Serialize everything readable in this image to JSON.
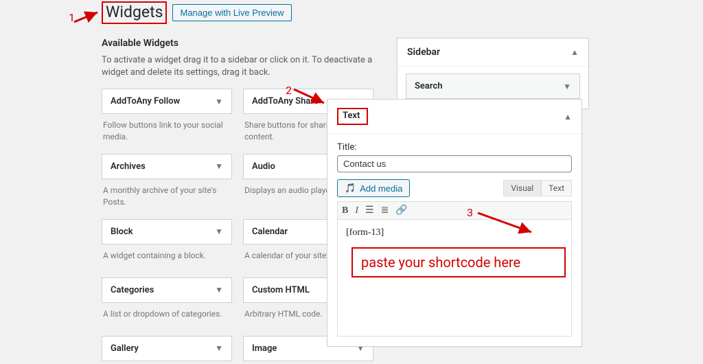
{
  "header": {
    "title": "Widgets",
    "live_preview": "Manage with Live Preview"
  },
  "available": {
    "title": "Available Widgets",
    "desc": "To activate a widget drag it to a sidebar or click on it. To deactivate a widget and delete its settings, drag it back."
  },
  "widgets": [
    {
      "name": "AddToAny Follow",
      "desc": "Follow buttons link to your social media."
    },
    {
      "name": "AddToAny Share",
      "desc": "Share buttons for sharing your content."
    },
    {
      "name": "Archives",
      "desc": "A monthly archive of your site's Posts."
    },
    {
      "name": "Audio",
      "desc": "Displays an audio player."
    },
    {
      "name": "Block",
      "desc": "A widget containing a block."
    },
    {
      "name": "Calendar",
      "desc": "A calendar of your site's posts."
    },
    {
      "name": "Categories",
      "desc": "A list or dropdown of categories."
    },
    {
      "name": "Custom HTML",
      "desc": "Arbitrary HTML code."
    },
    {
      "name": "Gallery",
      "desc": ""
    },
    {
      "name": "Image",
      "desc": ""
    }
  ],
  "sidebar": {
    "title": "Sidebar",
    "items": [
      {
        "label": "Search"
      }
    ]
  },
  "text_editor": {
    "header": "Text",
    "title_label": "Title:",
    "title_value": "Contact us",
    "add_media": "Add media",
    "tabs": {
      "visual": "Visual",
      "text": "Text"
    },
    "content": "[form-13]",
    "annotation": "paste your shortcode here"
  },
  "annot": {
    "n1": "1",
    "n2": "2",
    "n3": "3"
  }
}
